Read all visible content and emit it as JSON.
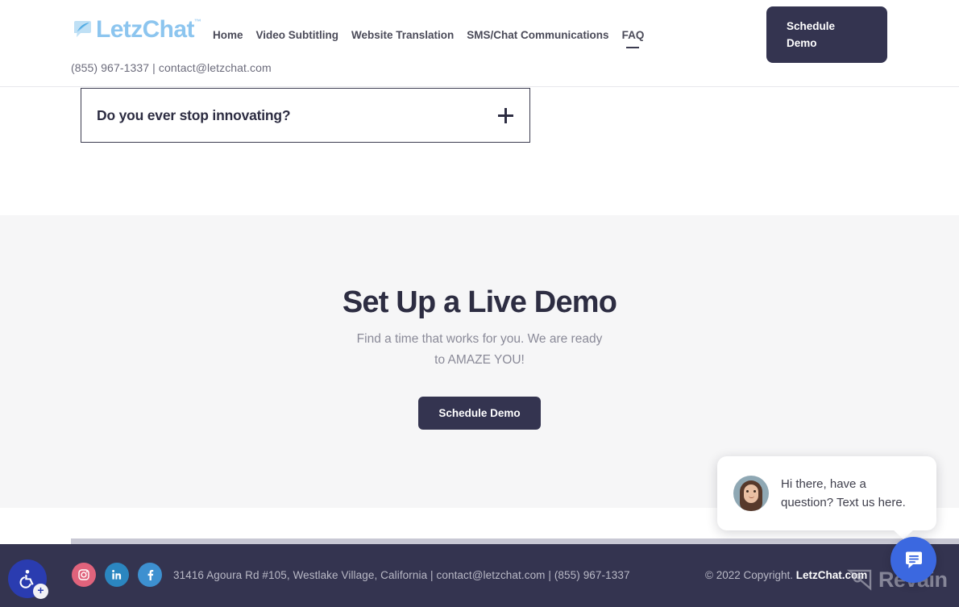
{
  "header": {
    "logo_text": "LetzChat",
    "logo_tm": "™",
    "nav": [
      {
        "label": "Home",
        "active": false
      },
      {
        "label": "Video Subtitling",
        "active": false
      },
      {
        "label": "Website Translation",
        "active": false
      },
      {
        "label": "SMS/Chat Communications",
        "active": false
      },
      {
        "label": "FAQ",
        "active": true
      }
    ],
    "cta_label": "Schedule\nDemo",
    "cta_line1": "Schedule",
    "cta_line2": "Demo",
    "contact_line": "(855) 967-1337 | contact@letzchat.com",
    "cta_color": "#343450"
  },
  "faq": {
    "question": "Do you ever stop innovating?",
    "toggle_icon": "plus-icon"
  },
  "demo": {
    "title": "Set Up a Live Demo",
    "subtitle_line1": "Find a time that works for you. We are ready",
    "subtitle_line2": "to AMAZE YOU!",
    "cta_label": "Schedule Demo",
    "background": "#f6f6f7"
  },
  "footer": {
    "social": [
      {
        "name": "instagram-icon",
        "color": "#e0637c"
      },
      {
        "name": "linkedin-icon",
        "color": "#2b86c0"
      },
      {
        "name": "facebook-icon",
        "color": "#3d90d0"
      }
    ],
    "address": "31416 Agoura Rd #105, Westlake Village, California | contact@letzchat.com | (855) 967-1337",
    "copyright_prefix": "© 2022 Copyright. ",
    "copyright_brand": "LetzChat.com",
    "background": "#343450"
  },
  "watermark": {
    "text": "Revain"
  },
  "accessibility": {
    "label": "accessibility-options",
    "plus": "+"
  },
  "chat": {
    "message_line1": "Hi there, have a",
    "message_line2": "question? Text us here.",
    "message_full": "Hi there, have a question? Text us here.",
    "launcher_color": "#3b68e0"
  }
}
